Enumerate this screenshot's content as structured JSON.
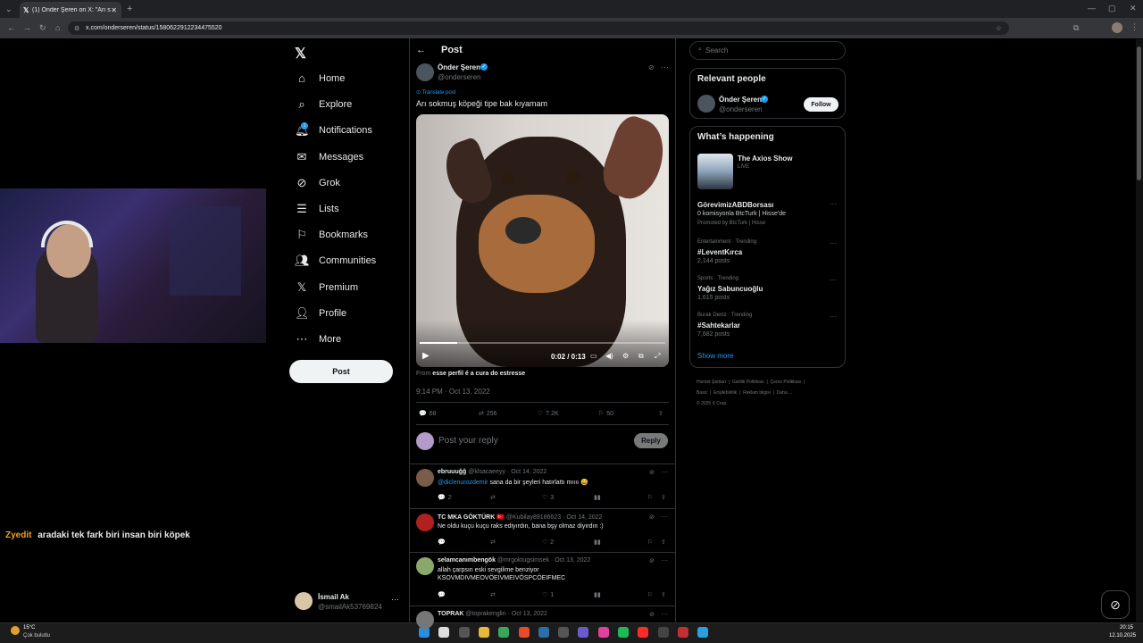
{
  "browser": {
    "tab_title": "(1) Önder Şeren on X: \"Arı sokm",
    "url": "x.com/onderseren/status/1580622912234475520"
  },
  "sidebar": {
    "items": [
      {
        "label": "Home",
        "icon": "home-icon"
      },
      {
        "label": "Explore",
        "icon": "search-icon"
      },
      {
        "label": "Notifications",
        "icon": "bell-icon"
      },
      {
        "label": "Messages",
        "icon": "mail-icon"
      },
      {
        "label": "Grok",
        "icon": "grok-icon"
      },
      {
        "label": "Lists",
        "icon": "list-icon"
      },
      {
        "label": "Bookmarks",
        "icon": "bookmark-icon"
      },
      {
        "label": "Communities",
        "icon": "people-icon"
      },
      {
        "label": "Premium",
        "icon": "x-logo-icon"
      },
      {
        "label": "Profile",
        "icon": "person-icon"
      },
      {
        "label": "More",
        "icon": "more-circle-icon"
      }
    ],
    "notification_badge": "1",
    "post_button": "Post",
    "account": {
      "name": "İsmail Ak",
      "handle": "@smailAk53769824"
    }
  },
  "chat_overlay": {
    "user": "Zyedit",
    "message": "aradaki tek fark biri insan biri köpek"
  },
  "post": {
    "header": "Post",
    "author": "Önder Şeren",
    "handle": "@onderseren",
    "translate": "Translate post",
    "text": "Arı sokmuş köpeği tipe bak kıyamam",
    "video_time": "0:02 / 0:13",
    "from_prefix": "From",
    "from_source": "esse perfil é a cura do estresse",
    "timestamp": "9:14 PM · Oct 13, 2022",
    "stats": {
      "replies": "68",
      "reposts": "256",
      "likes": "7.2K",
      "bookmarks": "50"
    },
    "reply_placeholder": "Post your reply",
    "reply_button": "Reply"
  },
  "replies": [
    {
      "name": "ebruuuğğ",
      "handle": "@klsacaeeyy",
      "date": "· Oct 14, 2022",
      "mention": "@diclenurozdemir",
      "text": "sana da bir şeyleri hatırlattı mıııı 😄",
      "line2": "",
      "replies": "2",
      "likes": "3"
    },
    {
      "name": "TC MKA GÖKTÜRK 🇹🇷",
      "handle": "@Kubilay89186623",
      "date": "· Oct 14, 2022",
      "mention": "",
      "text": "Ne oldu kuçu kuçu raks ediyırdın, bana bşy olmaz diyırdın :)",
      "line2": "",
      "replies": "",
      "likes": "2"
    },
    {
      "name": "selamcanımbengök",
      "handle": "@mrgoktugsimsek",
      "date": "· Oct 13, 2022",
      "mention": "",
      "text": "allah çarpsın eski sevgilime benziyor",
      "line2": "KSOVMDIVMEOVÖEIVMEIVÖSPCÖEIFMEC",
      "replies": "",
      "likes": "1"
    },
    {
      "name": "TOPRAK",
      "handle": "@toprakenglin",
      "date": "· Oct 13, 2022",
      "mention": "",
      "text": "",
      "line2": "",
      "replies": "",
      "likes": ""
    }
  ],
  "right": {
    "search_placeholder": "Search",
    "relevant_title": "Relevant people",
    "relevant_name": "Önder Şeren",
    "relevant_handle": "@onderseren",
    "follow": "Follow",
    "happening_title": "What’s happening",
    "live_show": "The Axios Show",
    "live_label": "LIVE",
    "trends": [
      {
        "context": "",
        "title": "GörevimizABDBorsası",
        "sub": "0 komisyonla BtcTurk | Hisse'de",
        "sub2": "Promoted by BtcTurk | Hisse"
      },
      {
        "context": "Entertainment · Trending",
        "title": "#LeventKırca",
        "sub": "2,144 posts",
        "sub2": ""
      },
      {
        "context": "Sports · Trending",
        "title": "Yağız Sabuncuoğlu",
        "sub": "1,615 posts",
        "sub2": ""
      },
      {
        "context": "Burak Deniz · Trending",
        "title": "#Sahtekarlar",
        "sub": "7,682 posts",
        "sub2": ""
      }
    ],
    "show_more": "Show more",
    "footer": [
      "Hizmet Şartları",
      "Gizlilik Politikası",
      "Çerez Politikası",
      "Basic",
      "Erişilebilirlik",
      "Reklam bilgisi",
      "Daha ...",
      "© 2025 X Corp."
    ]
  },
  "taskbar": {
    "weather_temp": "15°C",
    "weather_desc": "Çok bulutlu",
    "time": "20:15",
    "date": "12.10.2025"
  }
}
